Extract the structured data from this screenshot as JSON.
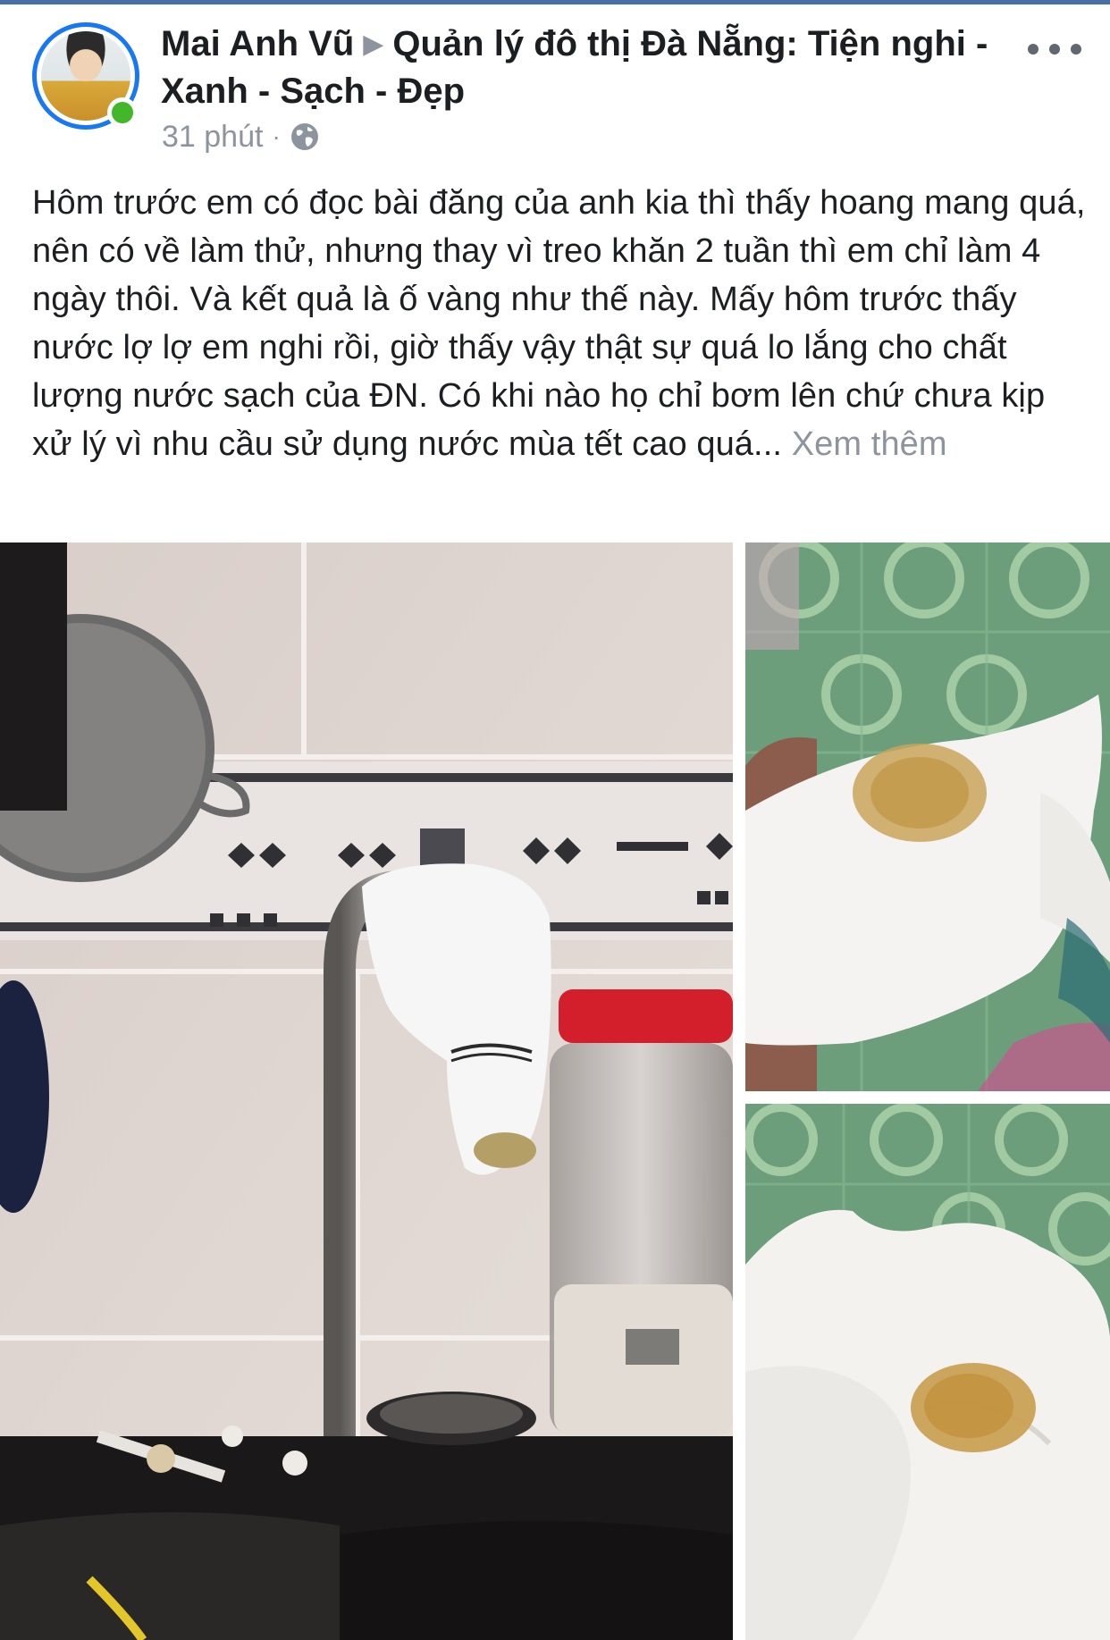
{
  "post": {
    "author": "Mai Anh Vũ",
    "arrow": "▶",
    "group": "Quản lý đô thị Đà Nẵng: Tiện nghi - Xanh - Sạch - Đẹp",
    "time": "31 phút",
    "separator": "·",
    "privacy_icon": "globe-icon",
    "more_icon": "more-options-icon",
    "body": "Hôm trước em có đọc bài đăng của anh kia thì thấy hoang mang quá, nên có về làm thử, nhưng thay vì treo khăn 2 tuần thì em chỉ làm 4 ngày thôi. Và kết quả là ố vàng như thế này. Mấy hôm trước thấy nước lợ lợ em nghi rồi, giờ thấy vậy thật sự quá lo lắng cho chất lượng nước sạch của ĐN. Có khi nào họ chỉ bơm lên chứ chưa kịp xử lý vì nhu cầu sử dụng nước mùa tết cao quá...",
    "see_more": "Xem thêm"
  },
  "photos": [
    {
      "name": "faucet-with-cloth-photo"
    },
    {
      "name": "stained-cloth-photo-1"
    },
    {
      "name": "stained-cloth-photo-2"
    }
  ],
  "colors": {
    "accent": "#1877f2",
    "online": "#42b72a",
    "muted": "#8d949e",
    "text": "#1c1e21"
  }
}
